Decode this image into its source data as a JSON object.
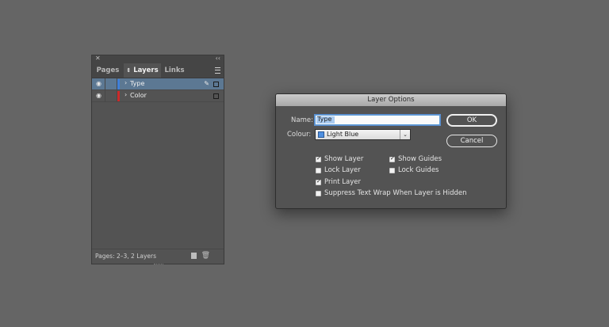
{
  "panel": {
    "tabs": [
      {
        "label": "Pages"
      },
      {
        "label": "Layers",
        "prefix_icon": "updown-arrows-icon"
      },
      {
        "label": "Links"
      }
    ],
    "layers": [
      {
        "name": "Type",
        "color": "#3f7fd8",
        "selected": true,
        "visible": true
      },
      {
        "name": "Color",
        "color": "#cc2a2a",
        "selected": false,
        "visible": true
      }
    ],
    "footer_text": "Pages: 2–3, 2 Layers"
  },
  "dialog": {
    "title": "Layer Options",
    "name_label": "Name:",
    "name_value": "Type",
    "colour_label": "Colour:",
    "colour_value": "Light Blue",
    "colour_swatch": "#4f8fe0",
    "ok_label": "OK",
    "cancel_label": "Cancel",
    "checkboxes": [
      {
        "label": "Show Layer",
        "checked": true
      },
      {
        "label": "Show Guides",
        "checked": true
      },
      {
        "label": "Lock Layer",
        "checked": false
      },
      {
        "label": "Lock Guides",
        "checked": false
      },
      {
        "label": "Print Layer",
        "checked": true
      },
      {
        "label": "Suppress Text Wrap When Layer is Hidden",
        "checked": false
      }
    ]
  }
}
